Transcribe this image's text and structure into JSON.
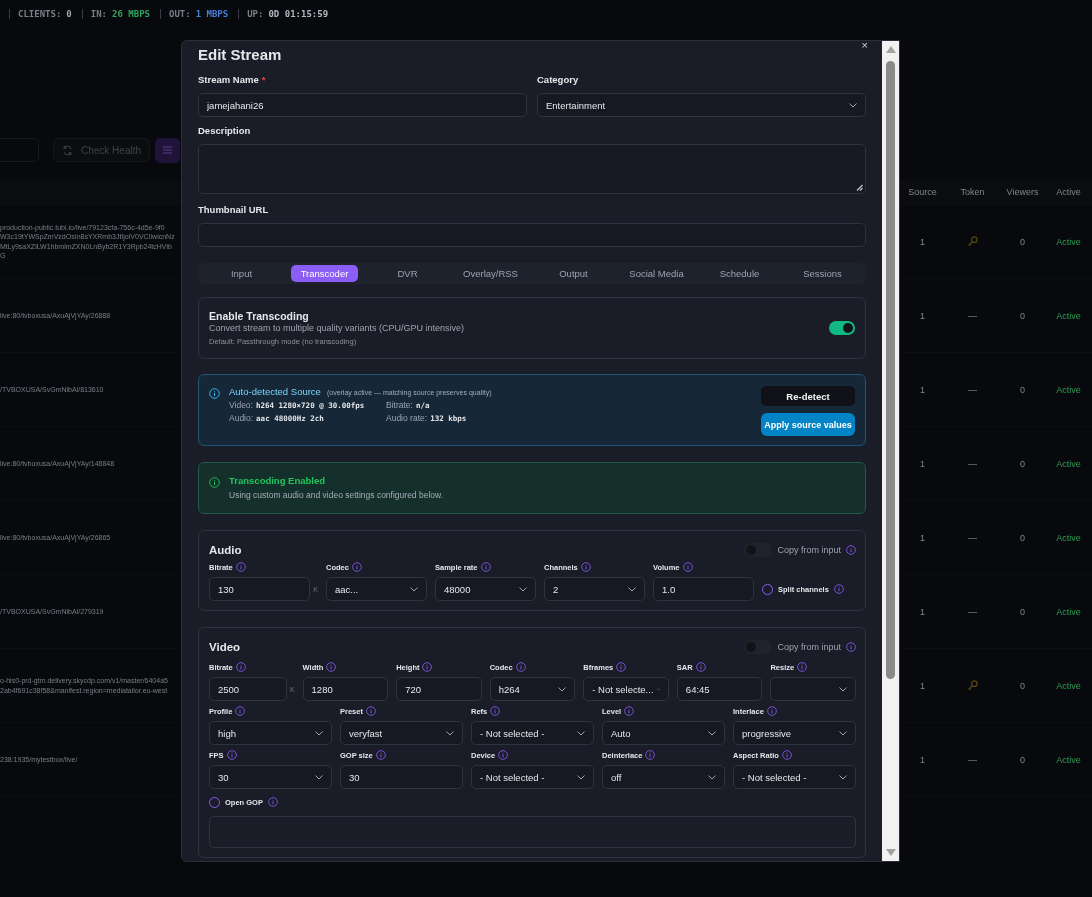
{
  "status_bar": [
    {
      "label": "CLIENTS:",
      "value": "0",
      "color": "#a0a5ad"
    },
    {
      "label": "IN:",
      "value": "26 MBPS",
      "color": "#2fa35c"
    },
    {
      "label": "OUT:",
      "value": "1 MBPS",
      "color": "#4a7fd6"
    },
    {
      "label": "UP:",
      "value": "0D 01:15:59",
      "color": "#b4b9c1"
    }
  ],
  "toolbar": {
    "check_health": "Check Health"
  },
  "table": {
    "columns": [
      "Source",
      "Token",
      "Viewers",
      "Active"
    ],
    "rows": [
      {
        "url_lines": [
          "production-public.tubi.io/live/79123cfa-756c-4d5e-9f0",
          "W3c19tYWSpZmVzdOsIn8sYXRmb3JtIjoiV0VCIiwicnNz",
          "MtLy9saXZlLW1hbmlmZXN0LnByb2R1Y3Rpb24tcHVibG"
        ],
        "source": "1",
        "token": {
          "kind": "key"
        },
        "viewers": "0",
        "status": "Active"
      },
      {
        "url_lines": [
          "live:80/tvboxusa/AxuAjVjYAy/26888"
        ],
        "source": "1",
        "token": {
          "kind": "text",
          "text": "—"
        },
        "viewers": "0",
        "status": "Active"
      },
      {
        "url_lines": [
          "/TVBOXUSA/SvGmNibAl/813610"
        ],
        "source": "1",
        "token": {
          "kind": "text",
          "text": "—"
        },
        "viewers": "0",
        "status": "Active"
      },
      {
        "url_lines": [
          "live:80/tvboxusa/AxuAjVjYAy/148848"
        ],
        "source": "1",
        "token": {
          "kind": "text",
          "text": "—"
        },
        "viewers": "0",
        "status": "Active"
      },
      {
        "url_lines": [
          "live:80/tvboxusa/AxuAjVjYAy/26865"
        ],
        "source": "1",
        "token": {
          "kind": "text",
          "text": "—"
        },
        "viewers": "0",
        "status": "Active"
      },
      {
        "url_lines": [
          "/TVBOXUSA/SvGmNibAl/279319"
        ],
        "source": "1",
        "token": {
          "kind": "text",
          "text": "—"
        },
        "viewers": "0",
        "status": "Active"
      },
      {
        "url_lines": [
          "o-hls0-prd-gtm.delivery.skycdp.com/v1/master/6404a5",
          "2ab4f691c38f58&manifest.region=mediatailor.eu-west"
        ],
        "source": "1",
        "token": {
          "kind": "key"
        },
        "viewers": "0",
        "status": "Active"
      },
      {
        "url_lines": [
          "238:1935/mytestbox/live/"
        ],
        "source": "1",
        "token": {
          "kind": "text",
          "text": "—"
        },
        "viewers": "0",
        "status": "Active"
      }
    ]
  },
  "dialog": {
    "title": "Edit Stream",
    "close": "×",
    "stream_name": {
      "label": "Stream Name",
      "required_mark": "*",
      "value": "jamejahani26"
    },
    "category": {
      "label": "Category",
      "value": "Entertainment"
    },
    "description": {
      "label": "Description"
    },
    "thumbnail_url": {
      "label": "Thumbnail URL"
    },
    "tabs": [
      {
        "label": "Input",
        "selected": false
      },
      {
        "label": "Transcoder",
        "selected": true
      },
      {
        "label": "DVR",
        "selected": false
      },
      {
        "label": "Overlay/RSS",
        "selected": false
      },
      {
        "label": "Output",
        "selected": false
      },
      {
        "label": "Social Media",
        "selected": false
      },
      {
        "label": "Schedule",
        "selected": false
      },
      {
        "label": "Sessions",
        "selected": false
      }
    ],
    "enable_transcoding": {
      "title": "Enable Transcoding",
      "description": "Convert stream to multiple quality variants (CPU/GPU intensive)",
      "hint": "Default: Passthrough mode (no transcoding)",
      "on": true
    },
    "source_info": {
      "title": "Auto-detected Source",
      "note": "(overlay active — matching source preserves quality)",
      "items": [
        {
          "label": "Video:",
          "value": "h264 1280×720 @ 30.00fps"
        },
        {
          "label": "Bitrate:",
          "value": "n/a"
        },
        {
          "label": "Audio:",
          "value": "aac 48000Hz 2ch"
        },
        {
          "label": "Audio rate:",
          "value": "132 kbps"
        }
      ],
      "redetect": "Re-detect",
      "apply": "Apply source values"
    },
    "status_notice": {
      "title": "Transcoding Enabled",
      "text": "Using custom audio and video settings configured below."
    },
    "audio": {
      "title": "Audio",
      "copy_from_input": {
        "label": "Copy from input",
        "on": false
      },
      "fields": [
        {
          "kind": "input",
          "label": "Bitrate",
          "value": "130",
          "unit": "K"
        },
        {
          "kind": "select",
          "label": "Codec",
          "value": "aac..."
        },
        {
          "kind": "select",
          "label": "Sample rate",
          "value": "48000"
        },
        {
          "kind": "select",
          "label": "Channels",
          "value": "2"
        },
        {
          "kind": "input",
          "label": "Volume",
          "value": "1.0"
        }
      ],
      "split_channels": {
        "label": "Split channels",
        "checked": false
      }
    },
    "video": {
      "title": "Video",
      "copy_from_input": {
        "label": "Copy from input",
        "on": false
      },
      "field_groups": [
        {
          "fields": [
            {
              "kind": "input",
              "label": "Bitrate",
              "value": "2500",
              "unit": "K"
            },
            {
              "kind": "input",
              "label": "Width",
              "value": "1280"
            },
            {
              "kind": "input",
              "label": "Height",
              "value": "720"
            },
            {
              "kind": "select",
              "label": "Codec",
              "value": "h264"
            },
            {
              "kind": "select",
              "label": "Bframes",
              "value": "- Not selecte..."
            },
            {
              "kind": "input",
              "label": "SAR",
              "value": "64:45"
            },
            {
              "kind": "select",
              "label": "Resize"
            }
          ]
        },
        {
          "fields": [
            {
              "kind": "select",
              "label": "Profile",
              "value": "high"
            },
            {
              "kind": "select",
              "label": "Preset",
              "value": "veryfast"
            },
            {
              "kind": "select",
              "label": "Refs",
              "value": "- Not selected -"
            },
            {
              "kind": "select",
              "label": "Level",
              "value": "Auto"
            },
            {
              "kind": "select",
              "label": "Interlace",
              "value": "progressive"
            }
          ]
        },
        {
          "fields": [
            {
              "kind": "select",
              "label": "FPS",
              "value": "30"
            },
            {
              "kind": "input",
              "label": "GOP size",
              "value": "30"
            },
            {
              "kind": "select",
              "label": "Device",
              "value": "- Not selected -"
            },
            {
              "kind": "select",
              "label": "Deinterlace",
              "value": "off"
            },
            {
              "kind": "select",
              "label": "Aspect Ratio",
              "value": "- Not selected -"
            }
          ]
        }
      ],
      "open_gop": {
        "label": "Open GOP",
        "checked": false
      }
    }
  }
}
